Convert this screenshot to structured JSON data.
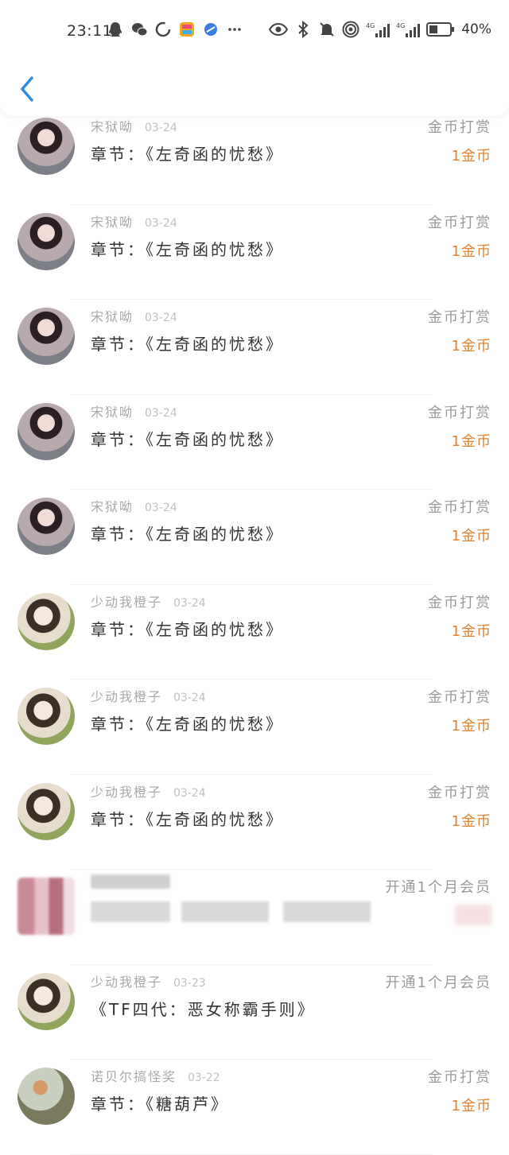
{
  "status_bar": {
    "time": "23:11",
    "battery": "40%",
    "left_icons": [
      "qq-icon",
      "wechat-icon",
      "circle-icon",
      "app-icon",
      "browser-icon",
      "more-icon"
    ],
    "right_icons": [
      "eye-icon",
      "bluetooth-icon",
      "mute-icon",
      "hotspot-icon",
      "signal-4g-icon",
      "signal-4g-icon",
      "battery-icon"
    ]
  },
  "header": {
    "back_icon": "chevron-left-icon"
  },
  "colors": {
    "accent": "#e3812d",
    "back": "#2d8fe0"
  },
  "records": [
    {
      "user": "宋狱呦",
      "date": "03-24",
      "content": "章节：《左奇函的忧愁》",
      "action": "金币打赏",
      "amount": "1金币",
      "avatar": "a"
    },
    {
      "user": "宋狱呦",
      "date": "03-24",
      "content": "章节：《左奇函的忧愁》",
      "action": "金币打赏",
      "amount": "1金币",
      "avatar": "a"
    },
    {
      "user": "宋狱呦",
      "date": "03-24",
      "content": "章节：《左奇函的忧愁》",
      "action": "金币打赏",
      "amount": "1金币",
      "avatar": "a"
    },
    {
      "user": "宋狱呦",
      "date": "03-24",
      "content": "章节：《左奇函的忧愁》",
      "action": "金币打赏",
      "amount": "1金币",
      "avatar": "a"
    },
    {
      "user": "宋狱呦",
      "date": "03-24",
      "content": "章节：《左奇函的忧愁》",
      "action": "金币打赏",
      "amount": "1金币",
      "avatar": "a"
    },
    {
      "user": "少动我橙子",
      "date": "03-24",
      "content": "章节：《左奇函的忧愁》",
      "action": "金币打赏",
      "amount": "1金币",
      "avatar": "b"
    },
    {
      "user": "少动我橙子",
      "date": "03-24",
      "content": "章节：《左奇函的忧愁》",
      "action": "金币打赏",
      "amount": "1金币",
      "avatar": "b"
    },
    {
      "user": "少动我橙子",
      "date": "03-24",
      "content": "章节：《左奇函的忧愁》",
      "action": "金币打赏",
      "amount": "1金币",
      "avatar": "b"
    },
    {
      "user": "",
      "date": "",
      "content": "",
      "action": "开通1个月会员",
      "amount": "",
      "avatar": "blur"
    },
    {
      "user": "少动我橙子",
      "date": "03-23",
      "content": "《TF四代：恶女称霸手则》",
      "action": "开通1个月会员",
      "amount": "",
      "avatar": "b"
    },
    {
      "user": "诺贝尔搞怪奖",
      "date": "03-22",
      "content": "章节：《糖葫芦》",
      "action": "金币打赏",
      "amount": "1金币",
      "avatar": "c"
    }
  ]
}
